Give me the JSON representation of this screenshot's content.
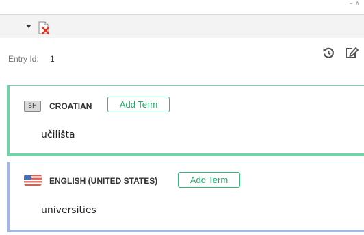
{
  "entry": {
    "id_label": "Entry Id:",
    "id_value": "1"
  },
  "toolbar": {
    "dropdown_icon": "chevron-down-icon",
    "delete_icon": "delete-document-icon"
  },
  "actions": {
    "history_icon": "history-icon",
    "edit_icon": "edit-icon"
  },
  "languages": [
    {
      "flag_text": "SH",
      "name": "CROATIAN",
      "add_term_label": "Add Term",
      "term": "učilišta",
      "accent": "#74d2a8"
    },
    {
      "flag_icon": "us-flag-icon",
      "name": "ENGLISH (UNITED STATES)",
      "add_term_label": "Add Term",
      "term": "universities",
      "accent": "#a3b7e2"
    }
  ],
  "colors": {
    "add_term": "#35b879",
    "toolbar_bg": "#f3f3f3"
  }
}
